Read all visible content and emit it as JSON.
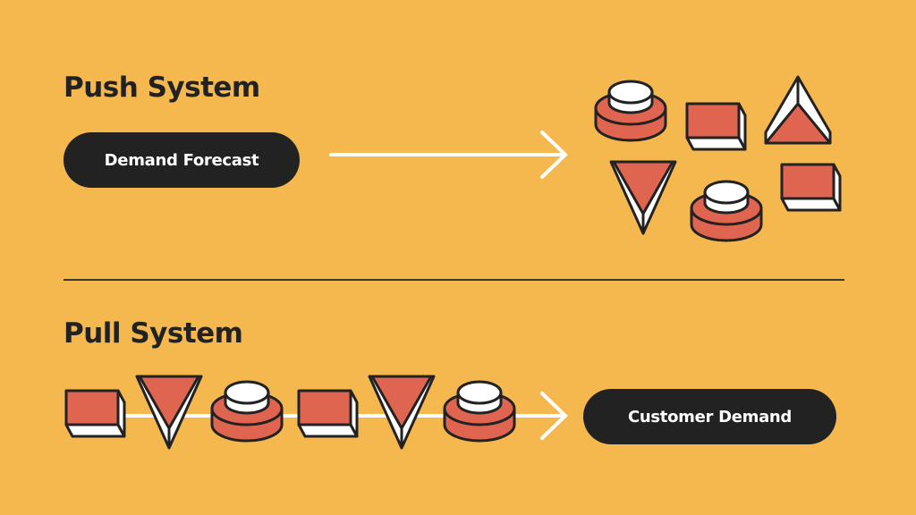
{
  "push": {
    "title": "Push System",
    "source_label": "Demand Forecast",
    "output_items": [
      "cylinder",
      "box",
      "triangle-up",
      "triangle-down",
      "cylinder",
      "box"
    ]
  },
  "pull": {
    "title": "Pull System",
    "sink_label": "Customer Demand",
    "flow_items": [
      "box",
      "triangle-down",
      "cylinder",
      "box",
      "triangle-down",
      "cylinder"
    ]
  },
  "colors": {
    "background": "#F5B84F",
    "shape_fill": "#DF6550",
    "shape_side": "#FFFFFF",
    "outline": "#222222",
    "pill": "#222222",
    "arrow": "#FFFFFF"
  }
}
